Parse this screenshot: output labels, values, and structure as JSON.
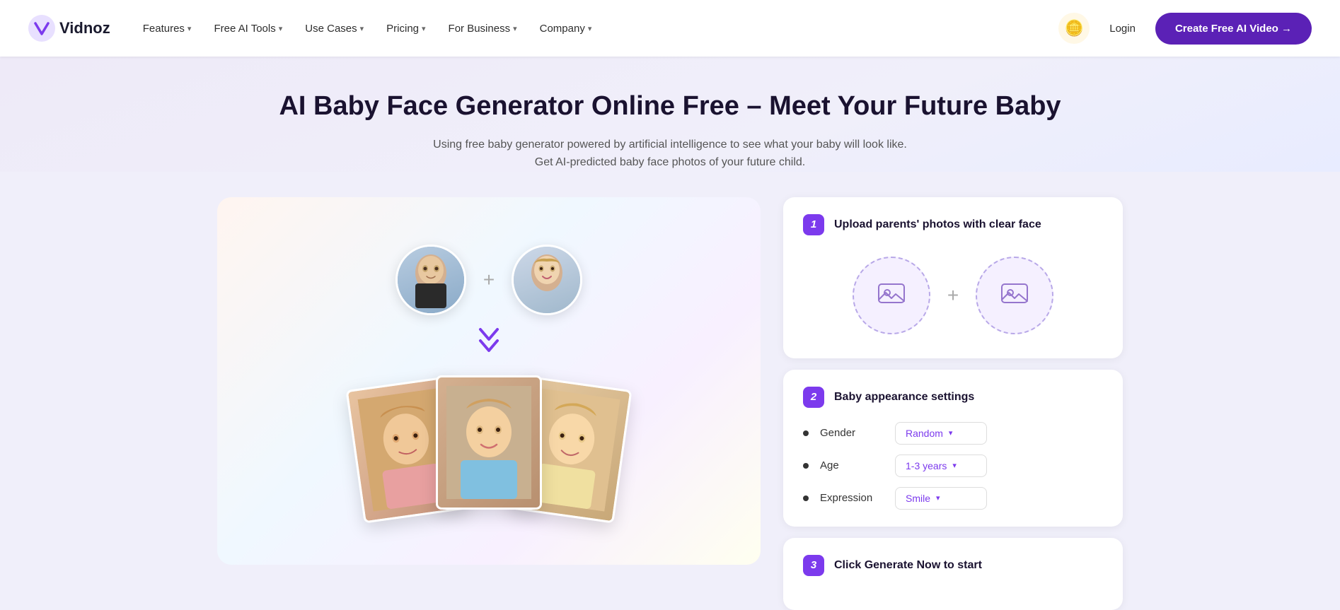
{
  "brand": {
    "name": "Vidnoz",
    "logo_letter": "V"
  },
  "nav": {
    "links": [
      {
        "label": "Features",
        "has_dropdown": true
      },
      {
        "label": "Free AI Tools",
        "has_dropdown": true
      },
      {
        "label": "Use Cases",
        "has_dropdown": true
      },
      {
        "label": "Pricing",
        "has_dropdown": true
      },
      {
        "label": "For Business",
        "has_dropdown": true
      },
      {
        "label": "Company",
        "has_dropdown": true
      }
    ],
    "login_label": "Login",
    "cta_label": "Create Free AI Video →"
  },
  "hero": {
    "title": "AI Baby Face Generator Online Free – Meet Your Future Baby",
    "subtitle_line1": "Using free baby generator powered by artificial intelligence to see what your baby will look like.",
    "subtitle_line2": "Get AI-predicted baby face photos of your future child."
  },
  "steps": {
    "step1": {
      "number": "1",
      "title": "Upload parents' photos with clear face",
      "upload_plus": "+"
    },
    "step2": {
      "number": "2",
      "title": "Baby appearance settings",
      "settings": [
        {
          "label": "Gender",
          "value": "Random"
        },
        {
          "label": "Age",
          "value": "1-3 years"
        },
        {
          "label": "Expression",
          "value": "Smile"
        }
      ]
    },
    "step3": {
      "number": "3",
      "title": "Click Generate Now to start"
    }
  },
  "colors": {
    "accent": "#7c3aed",
    "accent_light": "#f5f0ff",
    "cta_bg": "#5b21b6"
  }
}
